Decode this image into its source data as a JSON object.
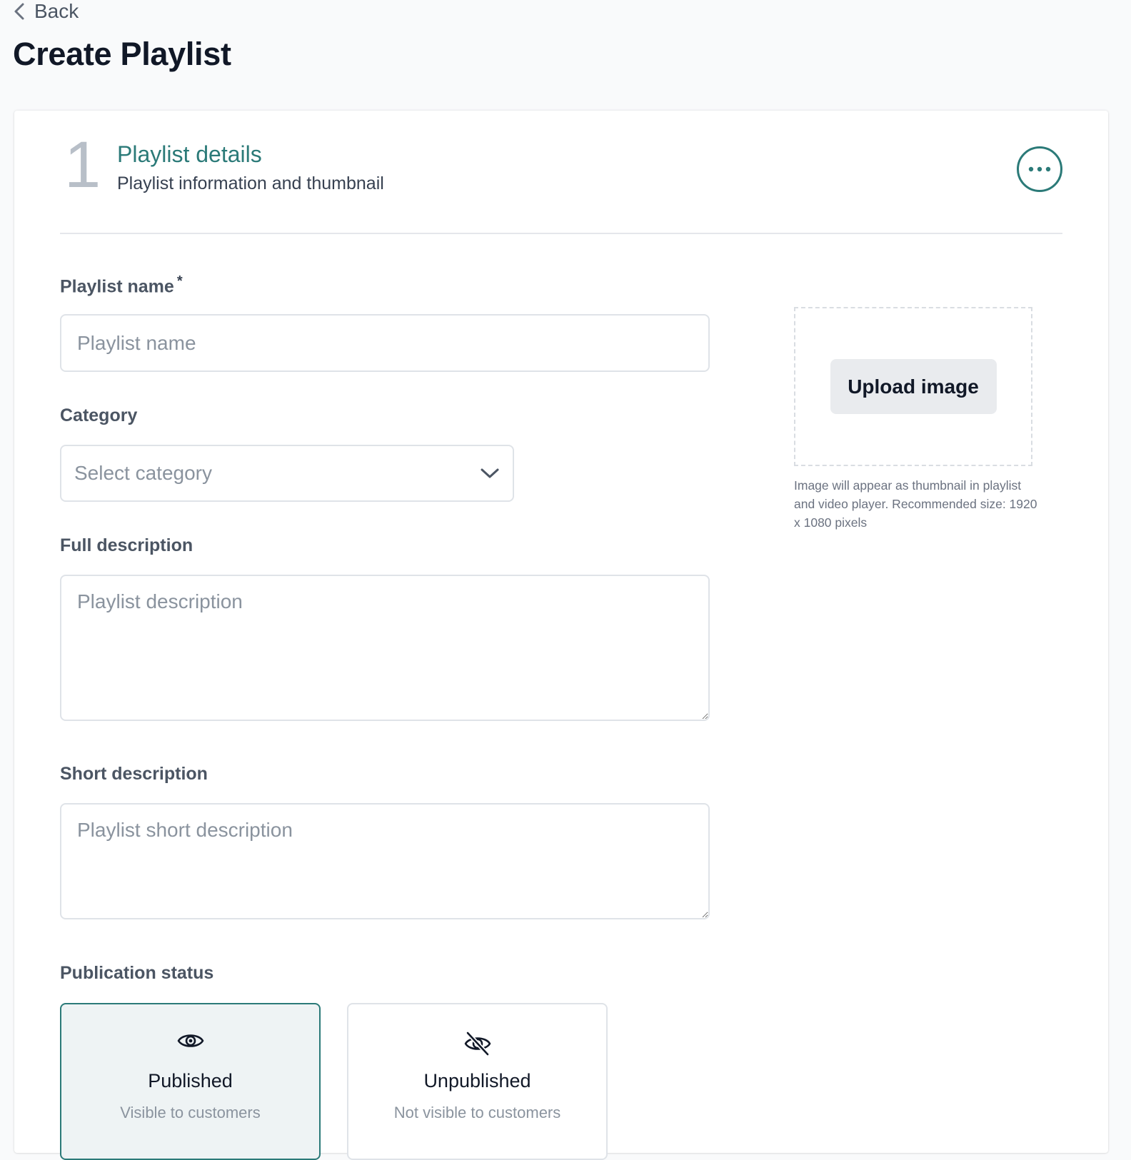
{
  "nav": {
    "back_label": "Back"
  },
  "page": {
    "title": "Create Playlist"
  },
  "step": {
    "number": "1",
    "title": "Playlist details",
    "subtitle": "Playlist information and thumbnail"
  },
  "form": {
    "name": {
      "label": "Playlist name",
      "required_mark": "*",
      "placeholder": "Playlist name",
      "value": ""
    },
    "category": {
      "label": "Category",
      "placeholder": "Select category"
    },
    "full_description": {
      "label": "Full description",
      "placeholder": "Playlist description",
      "value": ""
    },
    "short_description": {
      "label": "Short description",
      "placeholder": "Playlist short description",
      "value": ""
    },
    "publication_status": {
      "label": "Publication status",
      "options": [
        {
          "title": "Published",
          "subtitle": "Visible to customers",
          "icon": "eye-icon",
          "selected": true
        },
        {
          "title": "Unpublished",
          "subtitle": "Not visible to customers",
          "icon": "eye-off-icon",
          "selected": false
        }
      ]
    }
  },
  "thumbnail": {
    "upload_label": "Upload image",
    "hint": "Image will appear as thumbnail in playlist and video player. Recommended size: 1920 x 1080 pixels"
  },
  "colors": {
    "accent": "#2b7a78",
    "selected_bg": "#eef3f4",
    "page_bg": "#f9fafb"
  }
}
